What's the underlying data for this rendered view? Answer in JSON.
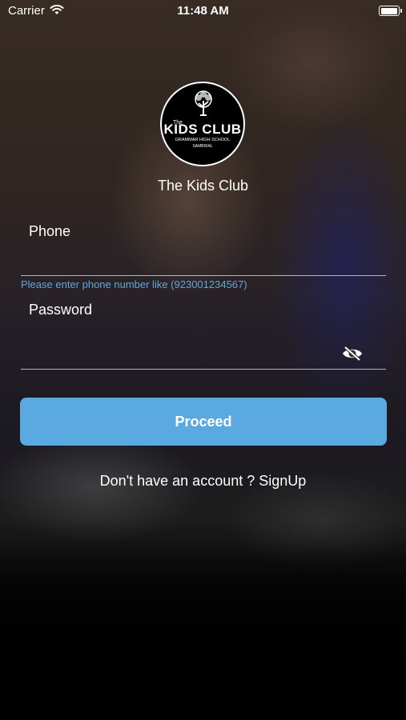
{
  "status_bar": {
    "carrier": "Carrier",
    "time": "11:48 AM",
    "icons": [
      "wifi-icon",
      "battery-icon"
    ],
    "battery_level": 1.0
  },
  "logo": {
    "the": "The",
    "main": "KIDS CLUB",
    "sub": "GRAMMAR HIGH SCHOOL",
    "sub2": "SAMBRIAL"
  },
  "app_title": "The Kids Club",
  "phone": {
    "label": "Phone",
    "value": "",
    "hint": "Please enter phone number like (923001234567)"
  },
  "password": {
    "label": "Password",
    "value": "",
    "toggle_icon": "eye-slash-icon"
  },
  "proceed_label": "Proceed",
  "signup": {
    "prompt": "Don't have an account ?",
    "link": "SignUp"
  },
  "colors": {
    "accent": "#5aa9e0",
    "text": "#ffffff"
  }
}
